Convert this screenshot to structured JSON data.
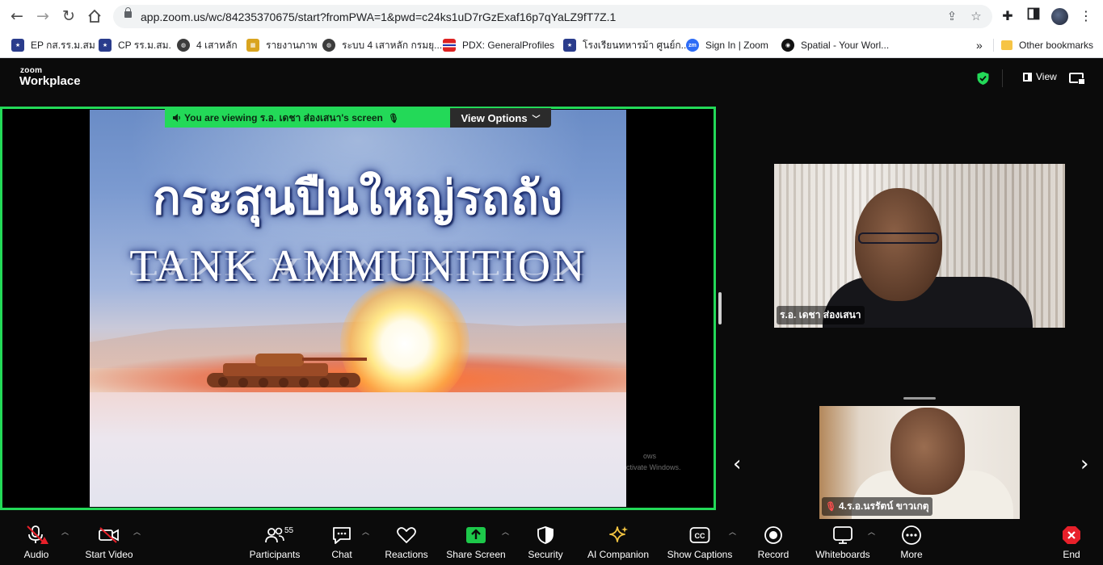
{
  "browser": {
    "url": "app.zoom.us/wc/84235370675/start?fromPWA=1&pwd=c24ks1uD7rGzExaf16p7qYaLZ9fT7Z.1",
    "bookmarks": [
      {
        "label": "EP กส.รร.ม.สม",
        "icon": "crest-icon"
      },
      {
        "label": "CP รร.ม.สม.",
        "icon": "crest-icon"
      },
      {
        "label": "4 เสาหลัก",
        "icon": "globe-icon"
      },
      {
        "label": "รายงานภาพ",
        "icon": "sheet-icon"
      },
      {
        "label": "ระบบ 4 เสาหลัก กรมยุ...",
        "icon": "globe-icon"
      },
      {
        "label": "PDX: GeneralProfiles",
        "icon": "flag-icon"
      },
      {
        "label": "โรงเรียนทหารม้า ศูนย์ก...",
        "icon": "crest-icon"
      },
      {
        "label": "Sign In | Zoom",
        "icon": "zoom-icon"
      },
      {
        "label": "Spatial - Your Worl...",
        "icon": "spatial-icon"
      }
    ],
    "more_bookmarks": "»",
    "other_bookmarks": "Other bookmarks"
  },
  "zoom": {
    "logo_small": "zoom",
    "logo_big": "Workplace",
    "view_label": "View"
  },
  "share": {
    "banner_text": "You are viewing  ร.อ. เดชา ส่องเสนา's screen",
    "view_options": "View Options",
    "slide_title_th": "กระสุนปืนใหญ่รถถัง",
    "slide_title_en": "TANK AMMUNITION",
    "watermark_line1": "ows",
    "watermark_line2": "ctivate Windows."
  },
  "participants": [
    {
      "name": "ร.อ. เดชา ส่องเสนา"
    },
    {
      "name": "4.ร.อ.นรรัตน์ ขาวเกตุ",
      "muted": true
    }
  ],
  "toolbar": {
    "audio": "Audio",
    "video": "Start Video",
    "participants": "Participants",
    "participant_count": "55",
    "chat": "Chat",
    "reactions": "Reactions",
    "share": "Share Screen",
    "security": "Security",
    "ai": "AI Companion",
    "captions": "Show Captions",
    "record": "Record",
    "whiteboards": "Whiteboards",
    "more": "More",
    "end": "End"
  },
  "colors": {
    "share_border": "#23d958",
    "end_red": "#e8202a",
    "share_green": "#1dc84a",
    "ai_yellow": "#f5c542"
  }
}
